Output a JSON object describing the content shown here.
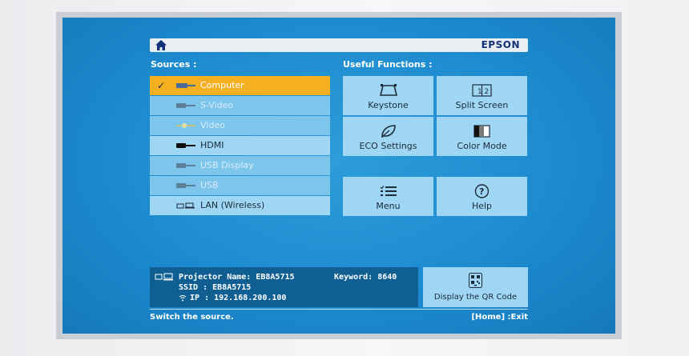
{
  "header": {
    "brand": "EPSON"
  },
  "sources": {
    "title": "Sources :",
    "items": [
      {
        "label": "Computer",
        "state": "selected"
      },
      {
        "label": "S-Video",
        "state": "disabled"
      },
      {
        "label": "Video",
        "state": "disabled"
      },
      {
        "label": "HDMI",
        "state": "enabled"
      },
      {
        "label": "USB Display",
        "state": "disabled"
      },
      {
        "label": "USB",
        "state": "disabled"
      },
      {
        "label": "LAN (Wireless)",
        "state": "enabled"
      }
    ]
  },
  "functions": {
    "title": "Useful Functions :",
    "keystone": "Keystone",
    "split_screen": "Split Screen",
    "eco_settings": "ECO Settings",
    "color_mode": "Color Mode",
    "menu": "Menu",
    "help": "Help"
  },
  "network": {
    "projector_name_label": "Projector Name:",
    "projector_name": "EB8A5715",
    "keyword_label": "Keyword:",
    "keyword": "8640",
    "ssid_label": "SSID :",
    "ssid": "EB8A5715",
    "ip_label": "IP :",
    "ip": "192.168.200.100"
  },
  "qr_button": "Display the QR Code",
  "footer": {
    "hint": "Switch the source.",
    "exit": "[Home] :Exit"
  },
  "colors": {
    "screen_blue": "#1d8bcf",
    "selected_orange": "#f5b021",
    "tile": "#9fd6f3",
    "info_panel": "#0f5f93",
    "brand": "#12307a"
  }
}
